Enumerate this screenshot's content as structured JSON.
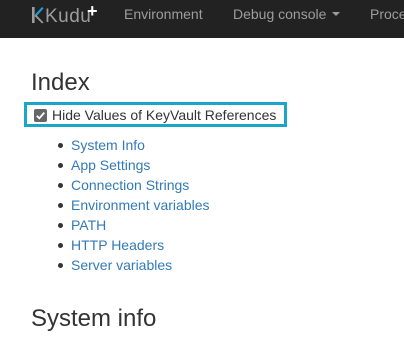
{
  "navbar": {
    "brand": "Kudu",
    "brand_plus": "+",
    "items": [
      {
        "label": "Environment"
      },
      {
        "label": "Debug console"
      },
      {
        "label": "Proce"
      }
    ]
  },
  "main": {
    "heading": "Index",
    "keyvault": {
      "label": "Hide Values of KeyVault References",
      "checked": true
    },
    "links": [
      {
        "label": "System Info"
      },
      {
        "label": "App Settings"
      },
      {
        "label": "Connection Strings"
      },
      {
        "label": "Environment variables"
      },
      {
        "label": "PATH"
      },
      {
        "label": "HTTP Headers"
      },
      {
        "label": "Server variables"
      }
    ],
    "section_heading": "System info"
  },
  "colors": {
    "navbar_bg": "#222222",
    "nav_text": "#9d9d9d",
    "link": "#337ab7",
    "highlight_border": "#1aa6c7",
    "brand_k_accent": "#1a9fd6"
  }
}
